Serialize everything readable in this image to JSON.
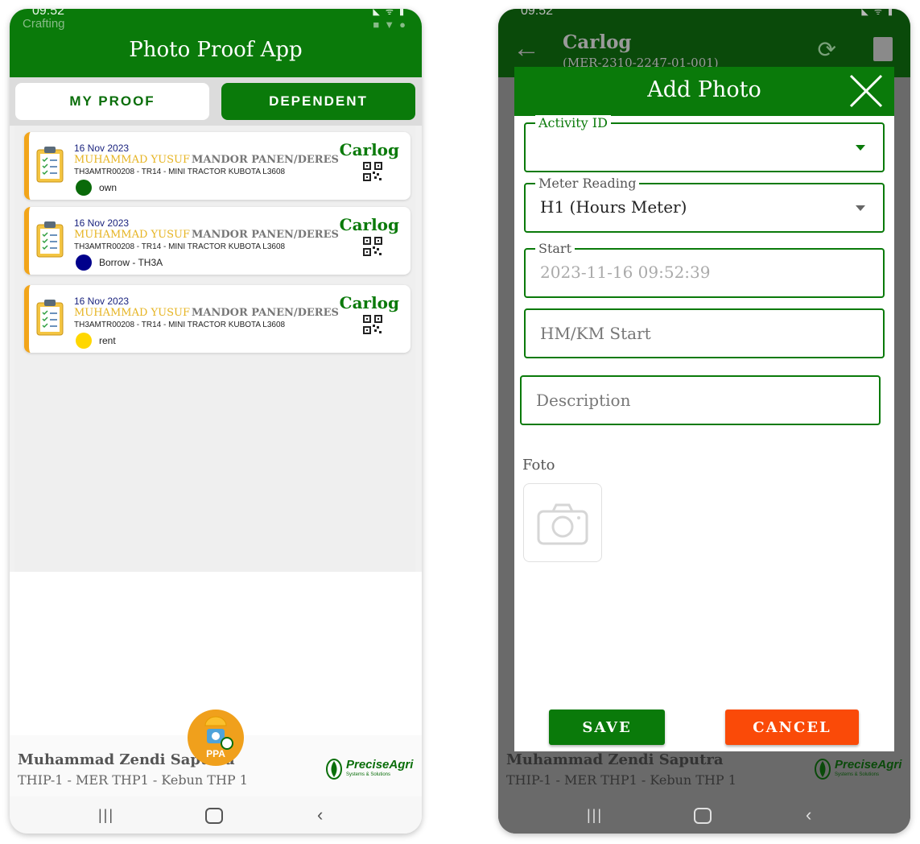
{
  "left": {
    "status": {
      "time": "09:52",
      "crafting": "Crafting"
    },
    "app_title": "Photo Proof App",
    "tabs": [
      {
        "label": "MY PROOF"
      },
      {
        "label": "DEPENDENT"
      }
    ],
    "cards": [
      {
        "date": "16 Nov 2023",
        "name": "MUHAMMAD YUSUF",
        "role": "MANDOR PANEN/DERES",
        "unit": "TH3AMTR00208 - TR14 - MINI TRACTOR KUBOTA L3608",
        "status": "own",
        "status_color": "#0a6a0a",
        "brand": "Carlog"
      },
      {
        "date": "16 Nov 2023",
        "name": "MUHAMMAD YUSUF",
        "role": "MANDOR PANEN/DERES",
        "unit": "TH3AMTR00208 - TR14 - MINI TRACTOR KUBOTA L3608",
        "status": "Borrow - TH3A",
        "status_color": "#00008b",
        "brand": "Carlog"
      },
      {
        "date": "16 Nov 2023",
        "name": "MUHAMMAD YUSUF",
        "role": "MANDOR PANEN/DERES",
        "unit": "TH3AMTR00208 - TR14 - MINI TRACTOR KUBOTA L3608",
        "status": "rent",
        "status_color": "#ffd700",
        "brand": "Carlog"
      }
    ],
    "fab_label": "PPA",
    "user": {
      "name": "Muhammad Zendi Saputra",
      "location": "THIP-1 - MER THP1 - Kebun THP 1"
    },
    "logo": {
      "text": "PreciseAgri",
      "sub": "Systems & Solutions"
    },
    "nav": {
      "recent": "|||",
      "back": "‹"
    }
  },
  "right": {
    "status": {
      "time": "09:52"
    },
    "header": {
      "title": "Carlog",
      "subtitle": "(MER-2310-2247-01-001)"
    },
    "dialog": {
      "title": "Add Photo",
      "fields": [
        {
          "label": "Activity ID",
          "value": ""
        },
        {
          "label": "Meter Reading",
          "value": "H1 (Hours Meter)"
        },
        {
          "label": "Start",
          "value": "2023-11-16 09:52:39"
        },
        {
          "label": "",
          "placeholder": "HM/KM Start"
        },
        {
          "label": "",
          "placeholder": "Description"
        }
      ],
      "foto_label": "Foto",
      "save_label": "SAVE",
      "cancel_label": "CANCEL"
    },
    "user": {
      "name": "Muhammad Zendi Saputra",
      "location": "THIP-1 - MER THP1 - Kebun THP 1"
    },
    "logo": {
      "text": "PreciseAgri",
      "sub": "Systems & Solutions"
    },
    "nav": {
      "recent": "|||",
      "back": "‹"
    }
  }
}
